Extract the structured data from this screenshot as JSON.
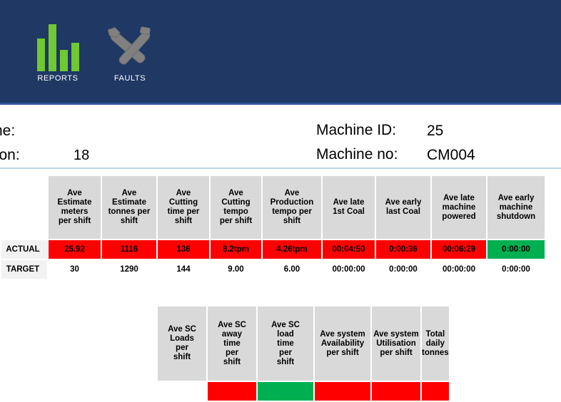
{
  "topbar": {
    "items": [
      {
        "id": "reports",
        "label": "REPORTS",
        "icon": "bar-chart-icon"
      },
      {
        "id": "faults",
        "label": "FAULTS",
        "icon": "tools-icon"
      }
    ]
  },
  "header": {
    "name_label": "ne:",
    "name_value": "",
    "position_label": "tion:",
    "position_value": "18",
    "machine_id_label": "Machine ID:",
    "machine_id_value": "25",
    "machine_no_label": "Machine no:",
    "machine_no_value": "CM004"
  },
  "table_top": {
    "row_labels": [
      "ACTUAL",
      "TARGET"
    ],
    "columns": [
      {
        "header_lines": [
          "Ave",
          "Estimate",
          "meters",
          "per shift"
        ],
        "actual": "25.92",
        "actual_state": "red",
        "target": "30",
        "target_state": "white"
      },
      {
        "header_lines": [
          "Ave",
          "Estimate",
          "tonnes per",
          "shift"
        ],
        "actual": "1116",
        "actual_state": "red",
        "target": "1290",
        "target_state": "white"
      },
      {
        "header_lines": [
          "Ave",
          "Cutting",
          "time per",
          "shift"
        ],
        "actual": "136",
        "actual_state": "red",
        "target": "144",
        "target_state": "white"
      },
      {
        "header_lines": [
          "Ave",
          "Cutting",
          "tempo",
          "per shift"
        ],
        "actual": "8.2tpm",
        "actual_state": "red",
        "target": "9.00",
        "target_state": "white"
      },
      {
        "header_lines": [
          "Ave",
          "Production",
          "tempo per",
          "shift"
        ],
        "actual": "4.26tpm",
        "actual_state": "red",
        "target": "6.00",
        "target_state": "white"
      },
      {
        "header_lines": [
          "Ave late",
          "1st Coal"
        ],
        "actual": "00:04:50",
        "actual_state": "red",
        "target": "00:00:00",
        "target_state": "white"
      },
      {
        "header_lines": [
          "Ave early",
          "last Coal"
        ],
        "actual": "0:00:36",
        "actual_state": "red",
        "target": "0:00:00",
        "target_state": "white"
      },
      {
        "header_lines": [
          "Ave late",
          "machine",
          "powered"
        ],
        "actual": "00:06:29",
        "actual_state": "red",
        "target": "00:00:00",
        "target_state": "white"
      },
      {
        "header_lines": [
          "Ave early",
          "machine",
          "shutdown"
        ],
        "actual": "0:00:00",
        "actual_state": "green",
        "target": "0:00:00",
        "target_state": "white"
      }
    ]
  },
  "table_bottom": {
    "columns": [
      {
        "header_lines": [
          "Ave SC",
          "Loads",
          "per",
          "shift"
        ],
        "actual": "",
        "actual_state": "white"
      },
      {
        "header_lines": [
          "Ave SC",
          "away",
          "time",
          "per",
          "shift"
        ],
        "actual": "",
        "actual_state": "red"
      },
      {
        "header_lines": [
          "Ave SC",
          "load",
          "time",
          "per",
          "shift"
        ],
        "actual": "",
        "actual_state": "green"
      },
      {
        "header_lines": [
          "Ave system",
          "Availability",
          "per shift"
        ],
        "actual": "",
        "actual_state": "red"
      },
      {
        "header_lines": [
          "Ave system",
          "Utilisation",
          "per shift"
        ],
        "actual": "",
        "actual_state": "red"
      },
      {
        "header_lines": [
          "Total",
          "daily",
          "tonnes"
        ],
        "actual": "",
        "actual_state": "red"
      }
    ]
  },
  "colors": {
    "navbar": "#1f3864",
    "navbar_border": "#2f5597",
    "icon_green": "#70c832",
    "icon_gray": "#808080",
    "header_cell": "#d9d9d9",
    "row_label_cell": "#f2f2f2",
    "bad": "#ff0000",
    "good": "#00b050"
  }
}
